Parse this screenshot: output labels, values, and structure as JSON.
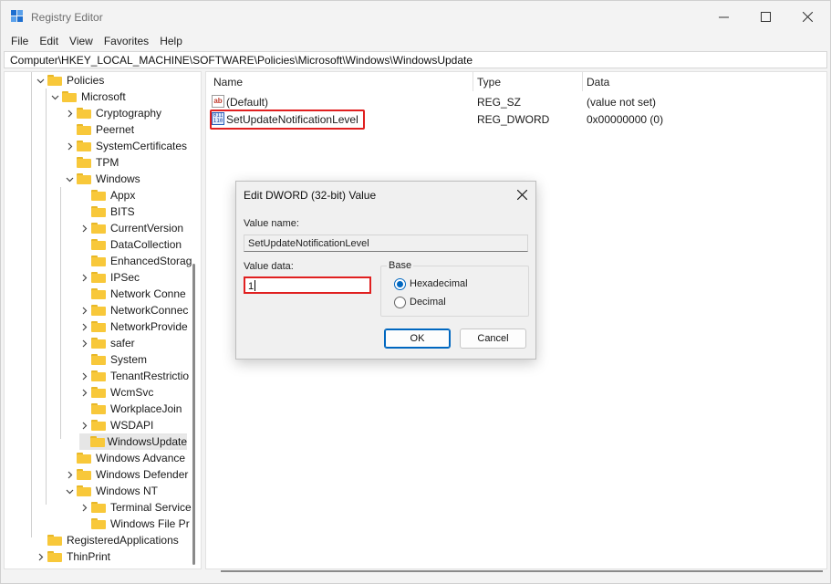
{
  "window": {
    "title": "Registry Editor"
  },
  "menu": [
    "File",
    "Edit",
    "View",
    "Favorites",
    "Help"
  ],
  "address": "Computer\\HKEY_LOCAL_MACHINE\\SOFTWARE\\Policies\\Microsoft\\Windows\\WindowsUpdate",
  "tree": [
    {
      "label": "Policies",
      "chevron": "down"
    },
    {
      "label": "Microsoft",
      "chevron": "down"
    },
    {
      "label": "Cryptography",
      "chevron": "right"
    },
    {
      "label": "Peernet",
      "chevron": "none"
    },
    {
      "label": "SystemCertificates",
      "chevron": "right"
    },
    {
      "label": "TPM",
      "chevron": "none"
    },
    {
      "label": "Windows",
      "chevron": "down"
    },
    {
      "label": "Appx",
      "chevron": "none"
    },
    {
      "label": "BITS",
      "chevron": "none"
    },
    {
      "label": "CurrentVersion",
      "chevron": "right"
    },
    {
      "label": "DataCollection",
      "chevron": "none"
    },
    {
      "label": "EnhancedStorag",
      "chevron": "none"
    },
    {
      "label": "IPSec",
      "chevron": "right"
    },
    {
      "label": "Network Conne",
      "chevron": "none"
    },
    {
      "label": "NetworkConnec",
      "chevron": "right"
    },
    {
      "label": "NetworkProvide",
      "chevron": "right"
    },
    {
      "label": "safer",
      "chevron": "right"
    },
    {
      "label": "System",
      "chevron": "none"
    },
    {
      "label": "TenantRestrictio",
      "chevron": "right"
    },
    {
      "label": "WcmSvc",
      "chevron": "right"
    },
    {
      "label": "WorkplaceJoin",
      "chevron": "none"
    },
    {
      "label": "WSDAPI",
      "chevron": "right"
    },
    {
      "label": "WindowsUpdate",
      "chevron": "none"
    },
    {
      "label": "Windows Advance",
      "chevron": "none"
    },
    {
      "label": "Windows Defender",
      "chevron": "right"
    },
    {
      "label": "Windows NT",
      "chevron": "down"
    },
    {
      "label": "Terminal Service",
      "chevron": "right"
    },
    {
      "label": "Windows File Pr",
      "chevron": "none"
    },
    {
      "label": "RegisteredApplications",
      "chevron": "none"
    },
    {
      "label": "ThinPrint",
      "chevron": "right"
    }
  ],
  "columns": {
    "name": "Name",
    "type": "Type",
    "data": "Data"
  },
  "values": [
    {
      "name": "(Default)",
      "type": "REG_SZ",
      "data": "(value not set)",
      "icon": "string-value-icon",
      "icon_text": "ab"
    },
    {
      "name": "SetUpdateNotificationLevel",
      "type": "REG_DWORD",
      "data": "0x00000000 (0)",
      "icon": "dword-value-icon",
      "icon_text": "011 110"
    }
  ],
  "dialog": {
    "title": "Edit DWORD (32-bit) Value",
    "value_name_label": "Value name:",
    "value_name": "SetUpdateNotificationLevel",
    "value_data_label": "Value data:",
    "value_data": "1",
    "base_label": "Base",
    "hex_label": "Hexadecimal",
    "dec_label": "Decimal",
    "selected_base": "Hexadecimal",
    "ok": "OK",
    "cancel": "Cancel"
  },
  "colors": {
    "accent": "#0067c0",
    "highlight": "#e02020",
    "folder": "#f8c83a"
  }
}
